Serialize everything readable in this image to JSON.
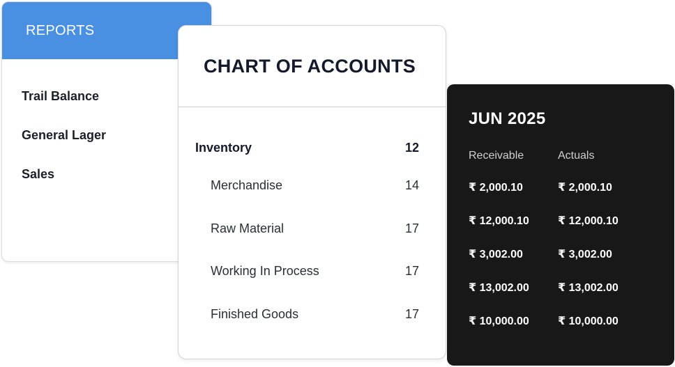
{
  "reports": {
    "header": "REPORTS",
    "items": [
      "Trail Balance",
      "General Lager",
      "Sales"
    ]
  },
  "chart_of_accounts": {
    "title": "CHART OF ACCOUNTS",
    "parent": {
      "label": "Inventory",
      "count": "12"
    },
    "children": [
      {
        "label": "Merchandise",
        "count": "14"
      },
      {
        "label": "Raw Material",
        "count": "17"
      },
      {
        "label": "Working In Process",
        "count": "17"
      },
      {
        "label": "Finished Goods",
        "count": "17"
      }
    ]
  },
  "period": {
    "title": "JUN 2025",
    "columns": [
      "Receivable",
      "Actuals"
    ],
    "rows": [
      {
        "receivable": "₹ 2,000.10",
        "actuals": "₹ 2,000.10"
      },
      {
        "receivable": "₹ 12,000.10",
        "actuals": "₹ 12,000.10"
      },
      {
        "receivable": "₹ 3,002.00",
        "actuals": "₹ 3,002.00"
      },
      {
        "receivable": "₹ 13,002.00",
        "actuals": "₹ 13,002.00"
      },
      {
        "receivable": "₹ 10,000.00",
        "actuals": "₹ 10,000.00"
      }
    ]
  },
  "colors": {
    "reports_header_bg": "#4a90e2",
    "period_card_bg": "#181818",
    "primary_text": "#141a2c"
  }
}
